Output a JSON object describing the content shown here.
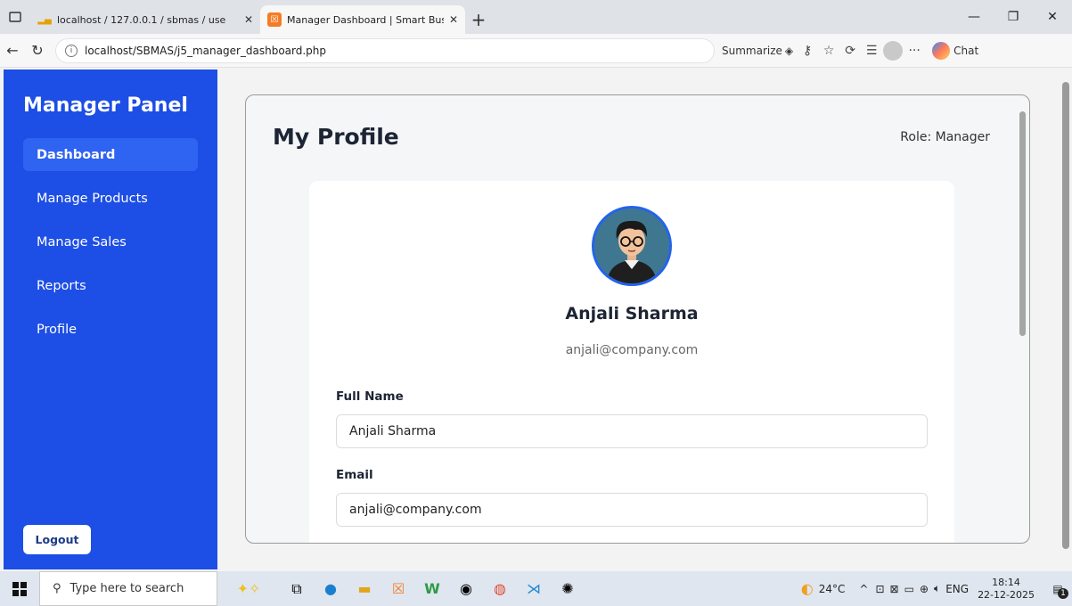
{
  "browser": {
    "tabs": [
      {
        "title": "localhost / 127.0.0.1 / sbmas / use",
        "close": "✕",
        "favicon": "phpmyadmin-icon"
      },
      {
        "title": "Manager Dashboard | Smart Busin",
        "close": "✕",
        "favicon": "xampp-icon"
      }
    ],
    "new_tab": "+",
    "window_controls": {
      "minimize": "—",
      "restore": "❐",
      "close": "✕"
    },
    "url": "localhost/SBMAS/j5_manager_dashboard.php",
    "summarize_label": "Summarize",
    "chat_label": "Chat",
    "more": "···"
  },
  "sidebar": {
    "brand": "Manager Panel",
    "items": [
      {
        "label": "Dashboard",
        "active": true
      },
      {
        "label": "Manage Products",
        "active": false
      },
      {
        "label": "Manage Sales",
        "active": false
      },
      {
        "label": "Reports",
        "active": false
      },
      {
        "label": "Profile",
        "active": false
      }
    ],
    "logout": "Logout"
  },
  "profile": {
    "title": "My Profile",
    "role": "Role: Manager",
    "name": "Anjali Sharma",
    "email": "anjali@company.com",
    "fields": [
      {
        "label": "Full Name",
        "value": "Anjali Sharma"
      },
      {
        "label": "Email",
        "value": "anjali@company.com"
      }
    ]
  },
  "taskbar": {
    "search_placeholder": "Type here to search",
    "weather": "24°C",
    "lang": "ENG",
    "time": "18:14",
    "date": "22-12-2025",
    "notifications": "1"
  },
  "colors": {
    "sidebar": "#1d4ee5",
    "sidebar_active": "#2f63f2",
    "avatar_border": "#2463eb"
  }
}
